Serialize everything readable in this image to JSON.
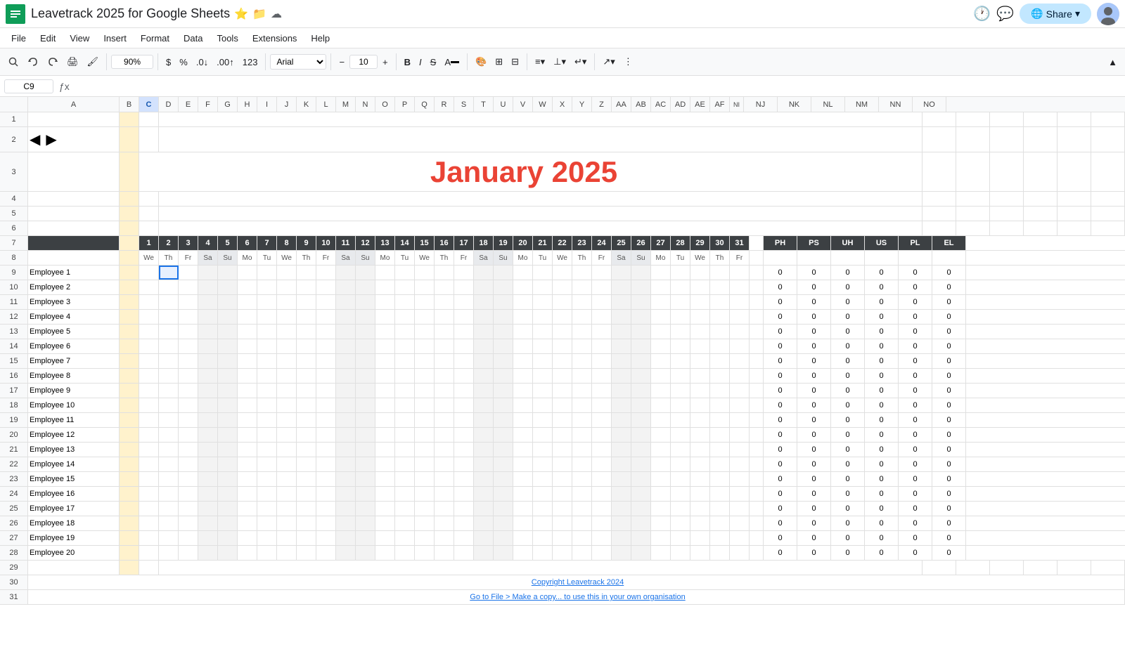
{
  "app": {
    "title": "Leavetrack 2025 for Google Sheets",
    "icon_char": "≡"
  },
  "titlebar": {
    "doc_title": "Leavetrack 2025 for Google Sheets",
    "star_icon": "★",
    "folder_icon": "📁",
    "cloud_icon": "☁",
    "history_icon": "🕐",
    "comment_icon": "💬",
    "share_label": "Share",
    "share_icon": "🌐"
  },
  "menubar": {
    "items": [
      "File",
      "Edit",
      "View",
      "Insert",
      "Format",
      "Data",
      "Tools",
      "Extensions",
      "Help"
    ]
  },
  "toolbar": {
    "zoom": "90%",
    "font_family": "Arial",
    "font_size": "10",
    "currency_symbol": "$",
    "percent_symbol": "%"
  },
  "formulabar": {
    "cell_ref": "C9",
    "formula": ""
  },
  "sheet": {
    "month_title": "January 2025",
    "nav_left": "◀",
    "nav_right": "▶",
    "days": [
      1,
      2,
      3,
      4,
      5,
      6,
      7,
      8,
      9,
      10,
      11,
      12,
      13,
      14,
      15,
      16,
      17,
      18,
      19,
      20,
      21,
      22,
      23,
      24,
      25,
      26,
      27,
      28,
      29,
      30,
      31
    ],
    "day_names": [
      "We",
      "Th",
      "Fr",
      "Sa",
      "Su",
      "Mo",
      "Tu",
      "We",
      "Th",
      "Fr",
      "Sa",
      "Su",
      "Mo",
      "Tu",
      "We",
      "Th",
      "Fr",
      "Sa",
      "Su",
      "Mo",
      "Tu",
      "We",
      "Th",
      "Fr",
      "Sa",
      "Su",
      "Mo",
      "Tu",
      "We",
      "Th",
      "Fr"
    ],
    "weekend_cols": [
      3,
      4,
      8,
      9,
      13,
      14,
      18,
      19,
      22,
      23,
      27,
      28,
      31
    ],
    "employees": [
      "Employee 1",
      "Employee 2",
      "Employee 3",
      "Employee 4",
      "Employee 5",
      "Employee 6",
      "Employee 7",
      "Employee 8",
      "Employee 9",
      "Employee 10",
      "Employee 11",
      "Employee 12",
      "Employee 13",
      "Employee 14",
      "Employee 15",
      "Employee 16",
      "Employee 17",
      "Employee 18",
      "Employee 19",
      "Employee 20"
    ],
    "summary_headers": [
      "PH",
      "PS",
      "UH",
      "US",
      "PL",
      "EL"
    ],
    "selected_cell": "C9",
    "footer_copyright": "Copyright Leavetrack 2024",
    "footer_instruction": "Go to File > Make a copy... to use this in your own organisation"
  },
  "columns": {
    "letters": [
      "A",
      "B",
      "C",
      "D",
      "E",
      "F",
      "G",
      "H",
      "I",
      "J",
      "K",
      "L",
      "M",
      "N",
      "O",
      "P",
      "Q",
      "R",
      "S",
      "T",
      "U",
      "V",
      "W",
      "X",
      "Y",
      "Z",
      "AA",
      "AB",
      "AC",
      "AD",
      "AE",
      "AF",
      "NI",
      "NJ",
      "NK",
      "NL",
      "NM",
      "NN",
      "NO"
    ]
  }
}
